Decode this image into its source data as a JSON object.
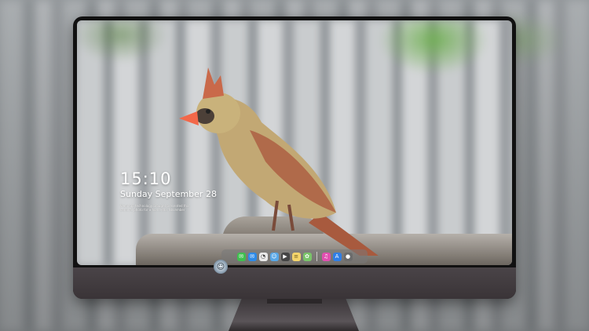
{
  "lockscreen": {
    "time": "15:10",
    "date": "Sunday September 28",
    "info_lines": [
      "Wenxtop technology brought presented this",
      "cardinal photo for a home this November"
    ]
  },
  "dock": {
    "apps": [
      {
        "name": "messages-app-icon",
        "glyph": "✉",
        "color": "#3fbf4f"
      },
      {
        "name": "mail-app-icon",
        "glyph": "✉",
        "color": "#2d8ae8"
      },
      {
        "name": "clock-app-icon",
        "glyph": "◔",
        "color": "#e9e9e9"
      },
      {
        "name": "finder-app-icon",
        "glyph": "☺",
        "color": "#58a7e6"
      },
      {
        "name": "clapper-app-icon",
        "glyph": "▶",
        "color": "#444444"
      },
      {
        "name": "notes-app-icon",
        "glyph": "≡",
        "color": "#f3d46b"
      },
      {
        "name": "photos-app-icon",
        "glyph": "✿",
        "color": "#7ac46a"
      },
      {
        "name": "music-app-icon",
        "glyph": "♫",
        "color": "#e04fb0"
      },
      {
        "name": "appstore-app-icon",
        "glyph": "A",
        "color": "#2f7ee6"
      },
      {
        "name": "camera-app-icon",
        "glyph": "●",
        "color": "#6b6b6b"
      }
    ]
  },
  "monitor": {
    "logo_glyph": "☺"
  },
  "colors": {
    "bezel": "#111111",
    "chin": "#3a3437",
    "text": "#ffffff"
  }
}
